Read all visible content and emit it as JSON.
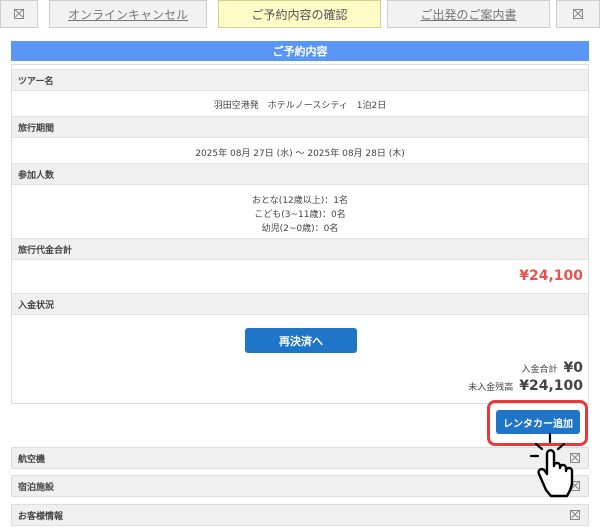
{
  "tabs": {
    "online_cancel": "オンラインキャンセル",
    "reservation_confirm": "ご予約内容の確認",
    "departure_info": "ご出発のご案内書"
  },
  "header": {
    "title": "ご予約内容"
  },
  "tour": {
    "label": "ツアー名",
    "value": "羽田空港発　ホテルノースシティ　1泊2日"
  },
  "period": {
    "label": "旅行期間",
    "value": "2025年 08月 27日 (水) ～ 2025年 08月 28日 (木)"
  },
  "participants": {
    "label": "参加人数",
    "adults": "おとな(12歳以上)：1名",
    "children": "こども(3~11歳)：0名",
    "infants": "幼児(2~0歳)：0名"
  },
  "total": {
    "label": "旅行代金合計",
    "value": "¥24,100"
  },
  "payment": {
    "label": "入金状況",
    "resettle_button": "再決済へ",
    "paid_label": "入金合計",
    "paid_value": "¥0",
    "unpaid_label": "未入金残高",
    "unpaid_value": "¥24,100"
  },
  "rental_car_button": "レンタカー追加",
  "accordions": {
    "flight": "航空機",
    "hotel": "宿泊施設",
    "customer": "お客様情報"
  },
  "colors": {
    "accent_blue": "#5a96f5",
    "button_blue": "#1f76c9",
    "price_red": "#e6534f",
    "highlight_red": "#e5393a",
    "active_tab": "#fffcc8"
  }
}
